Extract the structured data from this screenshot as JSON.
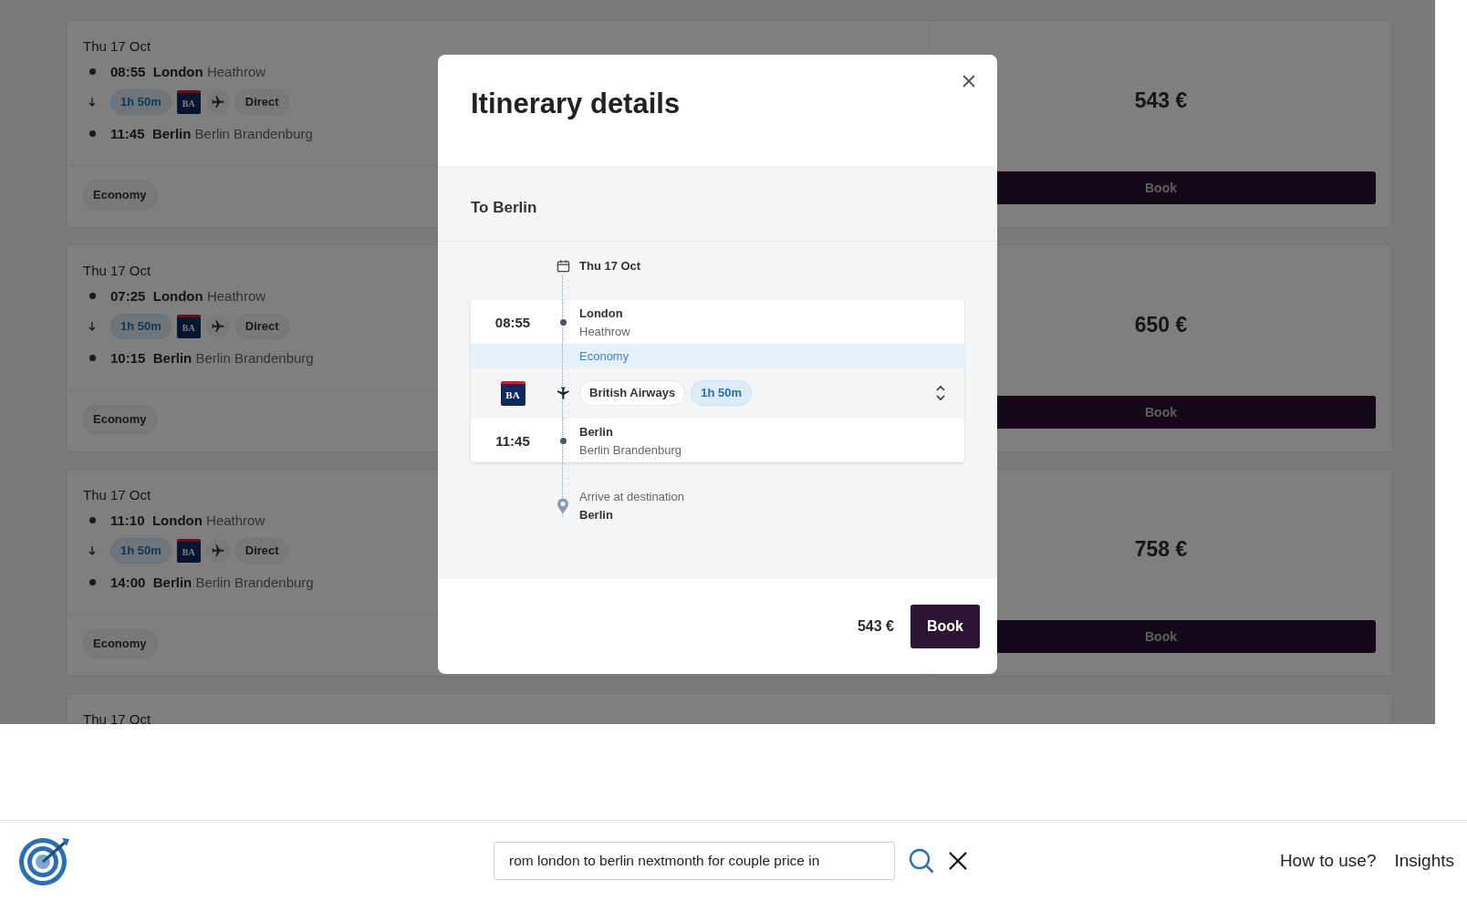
{
  "results": [
    {
      "date": "Thu 17 Oct",
      "departure": {
        "time": "08:55",
        "city": "London",
        "airport": "Heathrow"
      },
      "duration": "1h 50m",
      "airline_code": "BA",
      "stops": "Direct",
      "arrival": {
        "time": "11:45",
        "city": "Berlin",
        "airport": "Berlin Brandenburg"
      },
      "cabin": "Economy",
      "price": "543 €",
      "book_label": "Book"
    },
    {
      "date": "Thu 17 Oct",
      "departure": {
        "time": "07:25",
        "city": "London",
        "airport": "Heathrow"
      },
      "duration": "1h 50m",
      "airline_code": "BA",
      "stops": "Direct",
      "arrival": {
        "time": "10:15",
        "city": "Berlin",
        "airport": "Berlin Brandenburg"
      },
      "cabin": "Economy",
      "price": "650 €",
      "book_label": "Book"
    },
    {
      "date": "Thu 17 Oct",
      "departure": {
        "time": "11:10",
        "city": "London",
        "airport": "Heathrow"
      },
      "duration": "1h 50m",
      "airline_code": "BA",
      "stops": "Direct",
      "arrival": {
        "time": "14:00",
        "city": "Berlin",
        "airport": "Berlin Brandenburg"
      },
      "cabin": "Economy",
      "price": "758 €",
      "book_label": "Book"
    },
    {
      "date": "Thu 17 Oct"
    }
  ],
  "modal": {
    "title": "Itinerary details",
    "section_title": "To Berlin",
    "date": "Thu 17 Oct",
    "segment": {
      "departure": {
        "time": "08:55",
        "city": "London",
        "airport": "Heathrow"
      },
      "cabin": "Economy",
      "airline_code": "BA",
      "airline": "British Airways",
      "duration": "1h 50m",
      "arrival": {
        "time": "11:45",
        "city": "Berlin",
        "airport": "Berlin Brandenburg"
      }
    },
    "destination_label": "Arrive at destination",
    "destination": "Berlin",
    "price": "543 €",
    "book_label": "Book"
  },
  "bottom_bar": {
    "search": {
      "value": "rom london to berlin nextmonth for couple price in"
    },
    "links": [
      "How to use?",
      "Insights"
    ]
  }
}
